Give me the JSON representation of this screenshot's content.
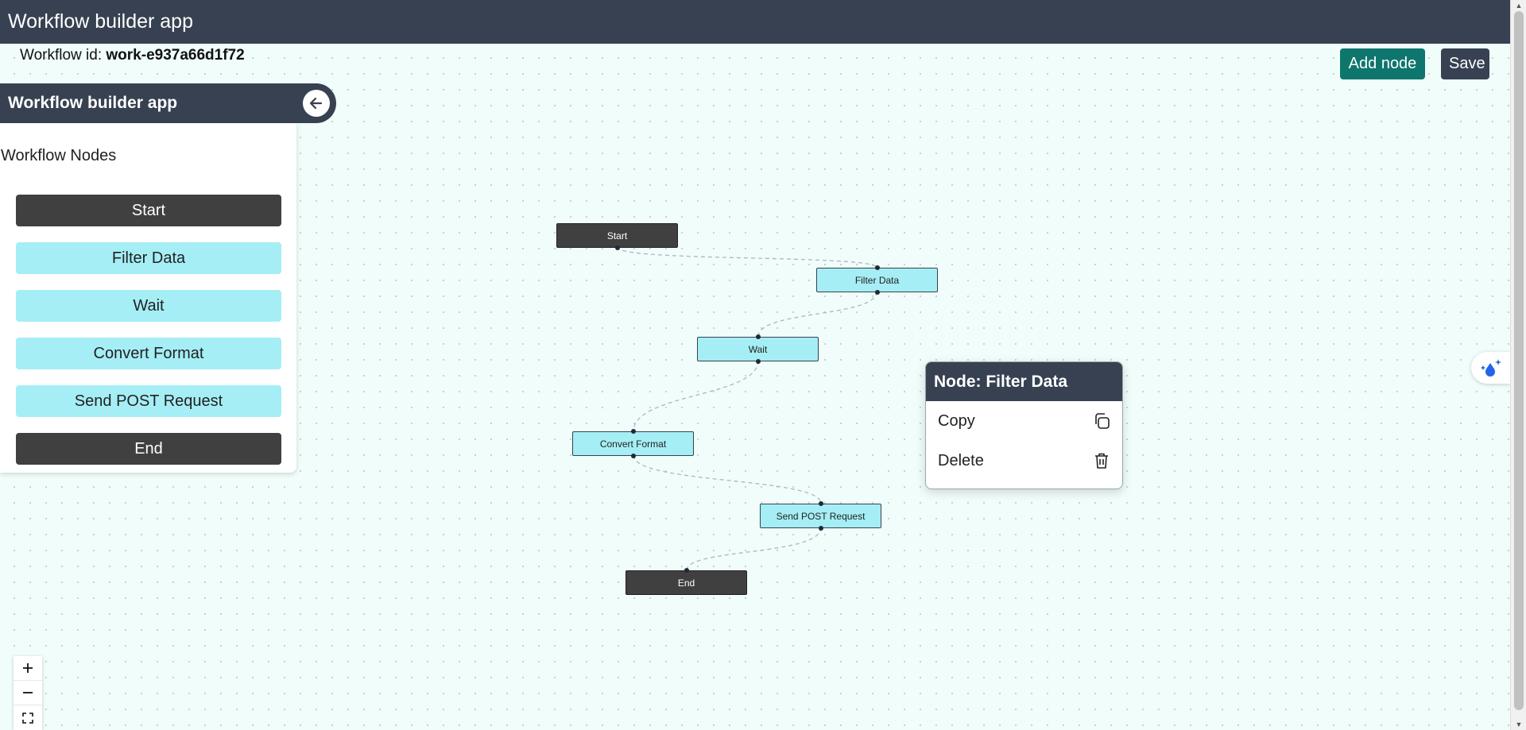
{
  "app": {
    "title": "Workflow builder app"
  },
  "workflow": {
    "id_label": "Workflow id:",
    "id_value": "work-e937a66d1f72"
  },
  "toolbar": {
    "add_node_label": "Add node",
    "save_label": "Save"
  },
  "sidebar": {
    "title": "Workflow builder app",
    "section_title": "Workflow Nodes",
    "items": [
      {
        "label": "Start",
        "kind": "dark"
      },
      {
        "label": "Filter Data",
        "kind": "light"
      },
      {
        "label": "Wait",
        "kind": "light"
      },
      {
        "label": "Convert Format",
        "kind": "light"
      },
      {
        "label": "Send POST Request",
        "kind": "light"
      },
      {
        "label": "End",
        "kind": "dark"
      }
    ]
  },
  "nodes": [
    {
      "label": "Start",
      "kind": "dark"
    },
    {
      "label": "Filter Data",
      "kind": "light"
    },
    {
      "label": "Wait",
      "kind": "light"
    },
    {
      "label": "Convert Format",
      "kind": "light"
    },
    {
      "label": "Send POST Request",
      "kind": "light"
    },
    {
      "label": "End",
      "kind": "dark"
    }
  ],
  "context_menu": {
    "title": "Node: Filter Data",
    "items": [
      {
        "label": "Copy",
        "icon": "copy-icon"
      },
      {
        "label": "Delete",
        "icon": "trash-icon"
      }
    ]
  },
  "zoom_controls": {
    "icons": [
      "plus-icon",
      "minus-icon",
      "fit-view-icon"
    ]
  },
  "colors": {
    "header": "#374151",
    "accent": "#0f766e",
    "node_light": "#a5eef5",
    "node_dark": "#404040",
    "canvas": "#f0fdfa"
  }
}
